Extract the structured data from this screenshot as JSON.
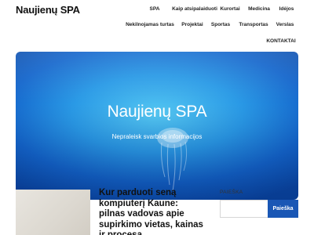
{
  "site": {
    "title": "Naujienų SPA"
  },
  "nav": {
    "items": [
      {
        "label": "SPA"
      },
      {
        "label": "Kaip atsipalaiduoti"
      },
      {
        "label": "Kurortai"
      },
      {
        "label": "Medicina"
      },
      {
        "label": "Idėjos"
      },
      {
        "label": "Nekilnojamas turtas"
      },
      {
        "label": "Projektai"
      },
      {
        "label": "Sportas"
      },
      {
        "label": "Transportas"
      },
      {
        "label": "Verslas"
      },
      {
        "label": "KONTAKTAI"
      }
    ]
  },
  "hero": {
    "title": "Naujienų SPA",
    "subtitle": "Nepraleisk svarbios informacijos"
  },
  "post": {
    "title": "Kur parduoti seną kompiuterį Kaune: pilnas vadovas apie supirkimo vietas, kainas ir procesą"
  },
  "search": {
    "label": "PAIEŠKA",
    "placeholder": "",
    "button_label": "Paieška"
  },
  "colors": {
    "accent": "#1a57b5",
    "hero_light": "#56c9f3",
    "hero_dark": "#0b4aa8"
  }
}
